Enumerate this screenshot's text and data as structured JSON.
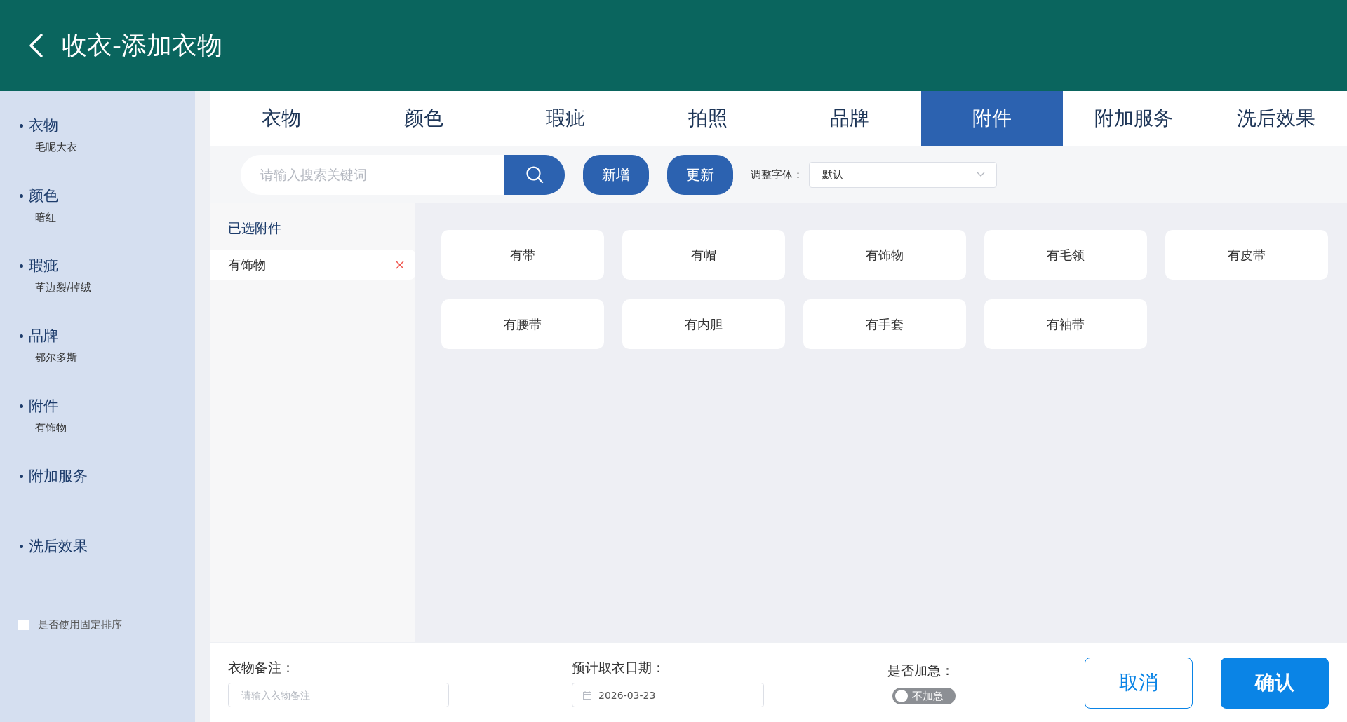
{
  "header": {
    "title": "收衣-添加衣物"
  },
  "sidebar": {
    "items": [
      {
        "label": "衣物",
        "value": "毛呢大衣"
      },
      {
        "label": "颜色",
        "value": "暗红"
      },
      {
        "label": "瑕疵",
        "value": "革边裂/掉绒"
      },
      {
        "label": "品牌",
        "value": "鄂尔多斯"
      },
      {
        "label": "附件",
        "value": "有饰物"
      },
      {
        "label": "附加服务"
      },
      {
        "label": "洗后效果"
      }
    ],
    "fixed_order": {
      "label": "是否使用固定排序",
      "checked": false
    }
  },
  "tabs": [
    {
      "label": "衣物",
      "selected": false
    },
    {
      "label": "颜色",
      "selected": false
    },
    {
      "label": "瑕疵",
      "selected": false
    },
    {
      "label": "拍照",
      "selected": false
    },
    {
      "label": "品牌",
      "selected": false
    },
    {
      "label": "附件",
      "selected": true
    },
    {
      "label": "附加服务",
      "selected": false
    },
    {
      "label": "洗后效果",
      "selected": false
    }
  ],
  "toolbar": {
    "search": {
      "placeholder": "请输入搜索关键词"
    },
    "buttons": [
      "新增",
      "更新"
    ],
    "font_select": {
      "label": "调整字体：",
      "value": "默认"
    }
  },
  "selected_panel": {
    "title": "已选附件",
    "items": [
      "有饰物"
    ]
  },
  "options": [
    "有带",
    "有帽",
    "有饰物",
    "有毛领",
    "有皮带",
    "有腰带",
    "有内胆",
    "有手套",
    "有袖带"
  ],
  "footer": {
    "remark": {
      "label": "衣物备注：",
      "placeholder": "请输入衣物备注"
    },
    "pickup_date": {
      "label": "预计取衣日期：",
      "value": "2026-03-23"
    },
    "urgent": {
      "label": "是否加急：",
      "on": false,
      "state_text": "不加急"
    },
    "buttons": [
      {
        "label": "取消",
        "kind": "secondary"
      },
      {
        "label": "确认",
        "kind": "primary"
      }
    ]
  }
}
